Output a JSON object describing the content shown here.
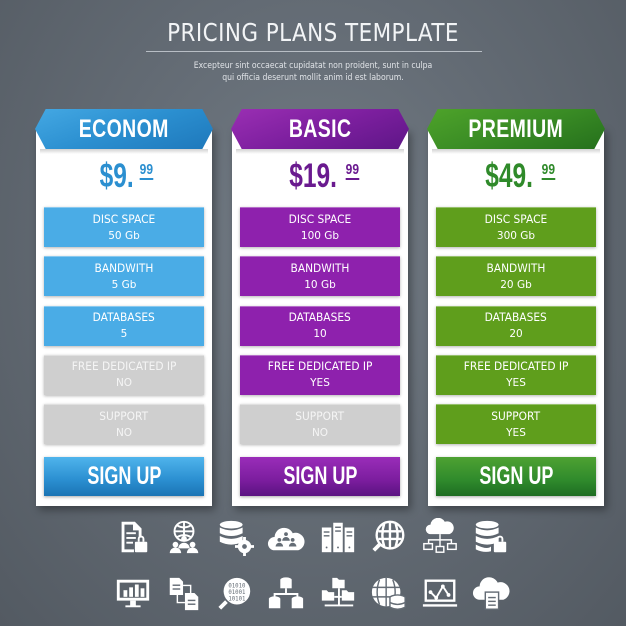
{
  "header": {
    "title": "PRICING PLANS TEMPLATE",
    "subtitle_line1": "Excepteur sint occaecat cupidatat non proident, sunt in culpa",
    "subtitle_line2": "qui officia deserunt mollit anim id est laborum."
  },
  "colors": {
    "econom": "#2b8fd0",
    "basic": "#7d1f9f",
    "premium": "#3a8c25",
    "disabled": "#cfcfcf",
    "background": "#646c75"
  },
  "plans": [
    {
      "name": "ECONOM",
      "price_main": "$9.",
      "price_cents": "99",
      "features": [
        {
          "label": "DISC SPACE",
          "value": "50 Gb",
          "enabled": true
        },
        {
          "label": "BANDWITH",
          "value": "5 Gb",
          "enabled": true
        },
        {
          "label": "DATABASES",
          "value": "5",
          "enabled": true
        },
        {
          "label": "FREE DEDICATED IP",
          "value": "NO",
          "enabled": false
        },
        {
          "label": "SUPPORT",
          "value": "NO",
          "enabled": false
        }
      ],
      "button": "SIGN UP"
    },
    {
      "name": "BASIC",
      "price_main": "$19.",
      "price_cents": "99",
      "features": [
        {
          "label": "DISC SPACE",
          "value": "100 Gb",
          "enabled": true
        },
        {
          "label": "BANDWITH",
          "value": "10 Gb",
          "enabled": true
        },
        {
          "label": "DATABASES",
          "value": "10",
          "enabled": true
        },
        {
          "label": "FREE DEDICATED IP",
          "value": "YES",
          "enabled": true
        },
        {
          "label": "SUPPORT",
          "value": "NO",
          "enabled": false
        }
      ],
      "button": "SIGN UP"
    },
    {
      "name": "PREMIUM",
      "price_main": "$49.",
      "price_cents": "99",
      "features": [
        {
          "label": "DISC SPACE",
          "value": "300 Gb",
          "enabled": true
        },
        {
          "label": "BANDWITH",
          "value": "20 Gb",
          "enabled": true
        },
        {
          "label": "DATABASES",
          "value": "20",
          "enabled": true
        },
        {
          "label": "FREE DEDICATED IP",
          "value": "YES",
          "enabled": true
        },
        {
          "label": "SUPPORT",
          "value": "YES",
          "enabled": true
        }
      ],
      "button": "SIGN UP"
    }
  ],
  "icons": {
    "row1": [
      "document-lock-icon",
      "globe-users-icon",
      "database-gear-icon",
      "cloud-users-icon",
      "server-rack-icon",
      "globe-search-icon",
      "cloud-network-icon",
      "database-lock-icon"
    ],
    "row2": [
      "monitor-chart-icon",
      "documents-transfer-icon",
      "binary-search-icon",
      "database-network-icon",
      "folder-network-icon",
      "globe-database-icon",
      "laptop-graph-icon",
      "cloud-document-icon"
    ]
  }
}
